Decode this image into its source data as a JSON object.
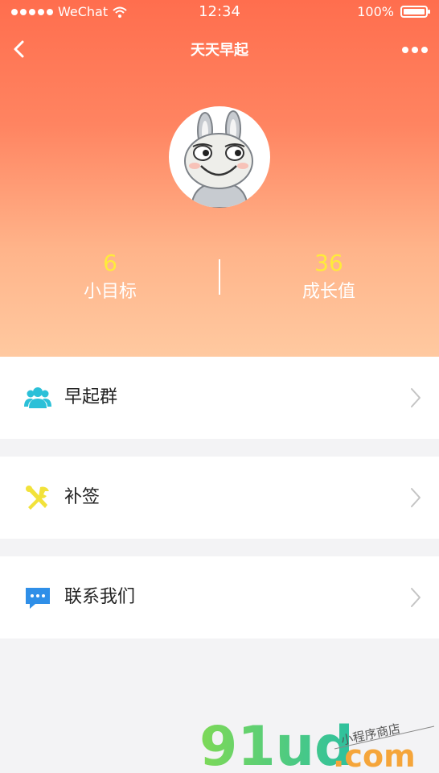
{
  "status_bar": {
    "carrier": "WeChat",
    "time": "12:34",
    "battery": "100%"
  },
  "nav": {
    "title": "天天早起"
  },
  "stats": {
    "goals": {
      "value": "6",
      "label": "小目标"
    },
    "growth": {
      "value": "36",
      "label": "成长值"
    }
  },
  "menu": [
    {
      "label": "早起群",
      "icon": "group-icon",
      "icon_color": "#2bc0d8"
    },
    {
      "label": "补签",
      "icon": "tools-icon",
      "icon_color": "#f2e23a"
    },
    {
      "label": "联系我们",
      "icon": "chat-icon",
      "icon_color": "#2f8fe8"
    }
  ],
  "watermark": {
    "brand": "91ud",
    "domain": ".com",
    "tagline": "小程序商店"
  },
  "colors": {
    "header_top": "#ff6e4e",
    "header_bottom": "#ffc9a0",
    "stat_value": "#ffeb3b",
    "page_bg": "#f3f3f5"
  }
}
